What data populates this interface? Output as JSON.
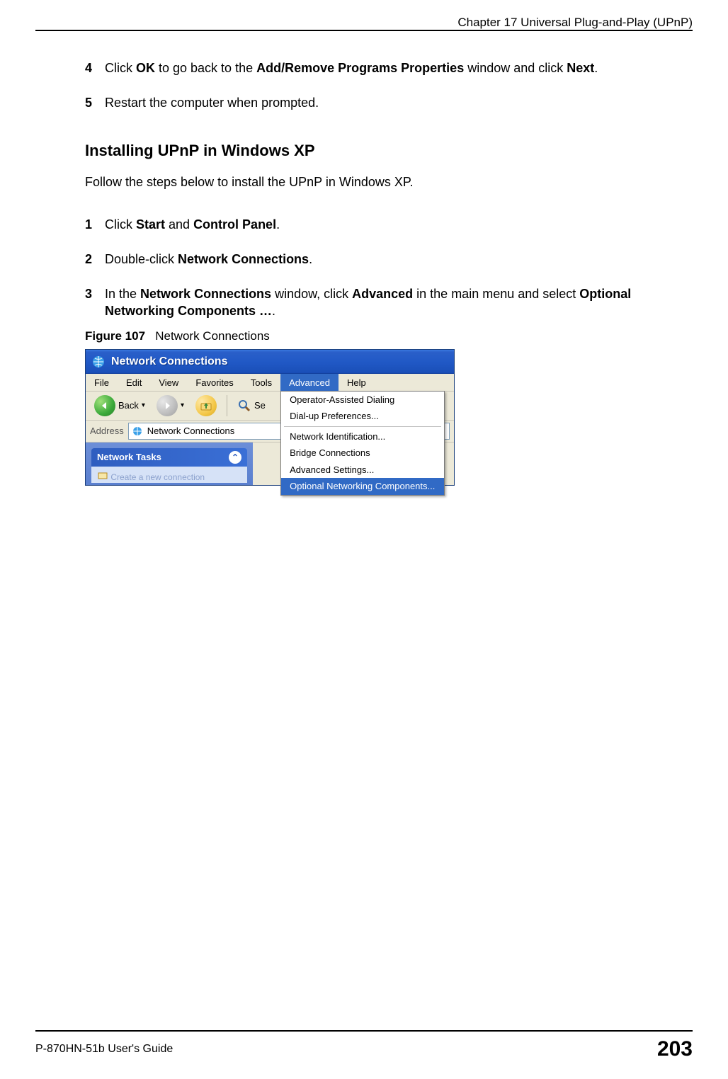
{
  "header": {
    "chapter": "Chapter 17 Universal Plug-and-Play (UPnP)"
  },
  "steps_prev": [
    {
      "num": "4",
      "pre": "Click ",
      "b1": "OK",
      "mid": " to go back to the ",
      "b2": "Add/Remove Programs Properties",
      "mid2": " window and click ",
      "b3": "Next",
      "post": "."
    },
    {
      "num": "5",
      "text": "Restart the computer when prompted."
    }
  ],
  "section": {
    "heading": "Installing UPnP in Windows XP",
    "intro": "Follow the steps below to install the UPnP in Windows XP."
  },
  "steps_xp": [
    {
      "num": "1",
      "pre": "Click ",
      "b1": "Start",
      "mid": " and ",
      "b2": "Control Panel",
      "post": "."
    },
    {
      "num": "2",
      "pre": "Double-click ",
      "b1": "Network Connections",
      "post": "."
    },
    {
      "num": "3",
      "pre": "In the ",
      "b1": "Network Connections",
      "mid": " window, click ",
      "b2": "Advanced",
      "mid2": " in the main menu and select ",
      "b3": "Optional Networking Components …",
      "post": "."
    }
  ],
  "figure": {
    "label": "Figure 107",
    "title": "Network Connections"
  },
  "xp": {
    "title": "Network Connections",
    "menu": [
      "File",
      "Edit",
      "View",
      "Favorites",
      "Tools",
      "Advanced",
      "Help"
    ],
    "menu_active_index": 5,
    "dropdown": {
      "group1": [
        "Operator-Assisted Dialing",
        "Dial-up Preferences..."
      ],
      "group2": [
        "Network Identification...",
        "Bridge Connections",
        "Advanced Settings...",
        "Optional Networking Components..."
      ],
      "highlight": "Optional Networking Components..."
    },
    "toolbar": {
      "back": "Back",
      "search_partial": "Se"
    },
    "addressbar": {
      "label": "Address",
      "value": "Network Connections"
    },
    "sidepanel": {
      "tasks_header": "Network Tasks",
      "task_item_partial": "Create a new connection"
    }
  },
  "footer": {
    "guide": "P-870HN-51b User's Guide",
    "page": "203"
  }
}
